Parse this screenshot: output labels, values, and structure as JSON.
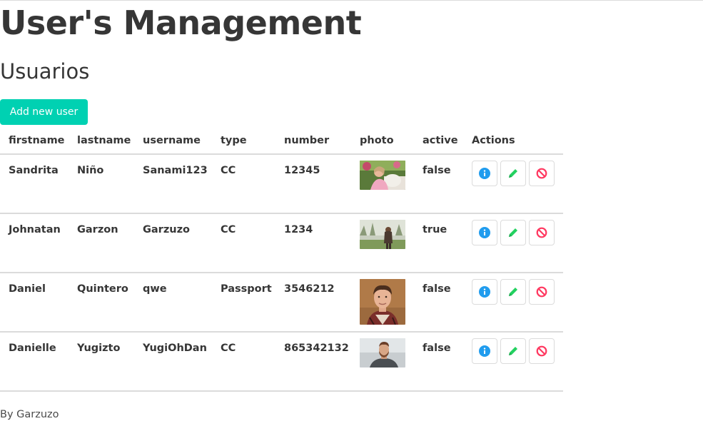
{
  "page": {
    "title": "User's Management",
    "subtitle": "Usuarios",
    "add_button_label": "Add new user",
    "footer": "By Garzuzo"
  },
  "table": {
    "columns": [
      "firstname",
      "lastname",
      "username",
      "type",
      "number",
      "photo",
      "active",
      "Actions"
    ],
    "rows": [
      {
        "firstname": "Sandrita",
        "lastname": "Niño",
        "username": "Sanami123",
        "type": "CC",
        "number": "12345",
        "active": "false",
        "photo_icon": "photo-girl-with-pet"
      },
      {
        "firstname": "Johnatan",
        "lastname": "Garzon",
        "username": "Garzuzo",
        "type": "CC",
        "number": "1234",
        "active": "true",
        "photo_icon": "photo-woman-in-park"
      },
      {
        "firstname": "Daniel",
        "lastname": "Quintero",
        "username": "qwe",
        "type": "Passport",
        "number": "3546212",
        "active": "false",
        "photo_icon": "photo-man-portrait"
      },
      {
        "firstname": "Danielle",
        "lastname": "Yugizto",
        "username": "YugiOhDan",
        "type": "CC",
        "number": "865342132",
        "active": "false",
        "photo_icon": "photo-bearded-man"
      }
    ]
  },
  "actions": {
    "info_icon": "info-icon",
    "edit_icon": "pencil-icon",
    "delete_icon": "ban-icon"
  },
  "colors": {
    "primary": "#00d1b2",
    "info": "#209cee",
    "edit": "#23d160",
    "delete": "#ff3860",
    "text": "#363636",
    "border": "#dbdbdb"
  }
}
